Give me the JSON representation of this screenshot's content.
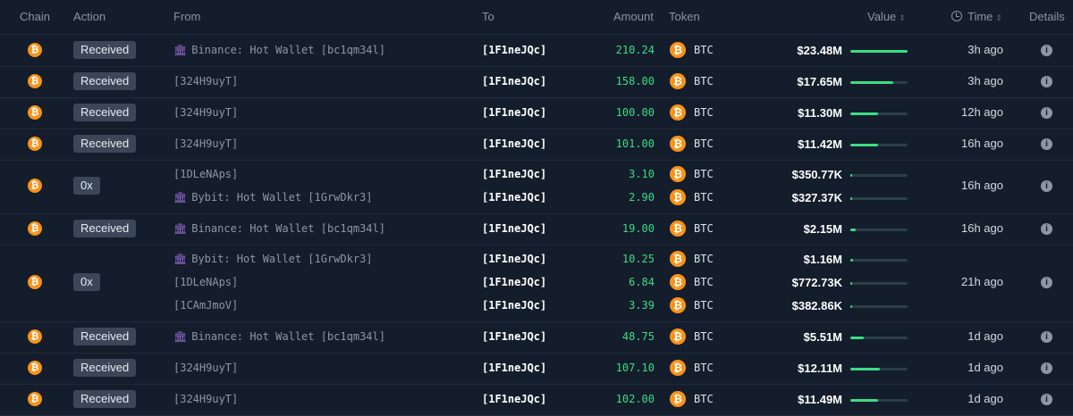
{
  "headers": {
    "chain": "Chain",
    "action": "Action",
    "from": "From",
    "to": "To",
    "amount": "Amount",
    "token": "Token",
    "value": "Value",
    "time": "Time",
    "details": "Details"
  },
  "icons": {
    "coin_glyph": "₿",
    "bank_glyph": "🏛",
    "info_glyph": "i",
    "sort_glyph": "⇕"
  },
  "colors": {
    "background": "#141d2b",
    "amount_green": "#3ddc84",
    "btc_orange": "#f7931a",
    "badge_bg": "#3b4658"
  },
  "rows": [
    {
      "action": "Received",
      "time": "3h ago",
      "lines": [
        {
          "from": "Binance: Hot Wallet [bc1qm34l]",
          "entity": true,
          "to": "[1F1neJQc]",
          "amount": "210.24",
          "token": "BTC",
          "value": "$23.48M",
          "bar": 1.0
        }
      ]
    },
    {
      "action": "Received",
      "time": "3h ago",
      "lines": [
        {
          "from": "[324H9uyT]",
          "entity": false,
          "to": "[1F1neJQc]",
          "amount": "158.00",
          "token": "BTC",
          "value": "$17.65M",
          "bar": 0.75
        }
      ]
    },
    {
      "action": "Received",
      "time": "12h ago",
      "lines": [
        {
          "from": "[324H9uyT]",
          "entity": false,
          "to": "[1F1neJQc]",
          "amount": "100.00",
          "token": "BTC",
          "value": "$11.30M",
          "bar": 0.48
        }
      ]
    },
    {
      "action": "Received",
      "time": "16h ago",
      "lines": [
        {
          "from": "[324H9uyT]",
          "entity": false,
          "to": "[1F1neJQc]",
          "amount": "101.00",
          "token": "BTC",
          "value": "$11.42M",
          "bar": 0.49
        }
      ]
    },
    {
      "action": "0x",
      "time": "16h ago",
      "lines": [
        {
          "from": "[1DLeNAps]",
          "entity": false,
          "to": "[1F1neJQc]",
          "amount": "3.10",
          "token": "BTC",
          "value": "$350.77K",
          "bar": 0.0
        },
        {
          "from": "Bybit: Hot Wallet [1GrwDkr3]",
          "entity": true,
          "to": "[1F1neJQc]",
          "amount": "2.90",
          "token": "BTC",
          "value": "$327.37K",
          "bar": 0.0
        }
      ]
    },
    {
      "action": "Received",
      "time": "16h ago",
      "lines": [
        {
          "from": "Binance: Hot Wallet [bc1qm34l]",
          "entity": true,
          "to": "[1F1neJQc]",
          "amount": "19.00",
          "token": "BTC",
          "value": "$2.15M",
          "bar": 0.09
        }
      ]
    },
    {
      "action": "0x",
      "time": "21h ago",
      "lines": [
        {
          "from": "Bybit: Hot Wallet [1GrwDkr3]",
          "entity": true,
          "to": "[1F1neJQc]",
          "amount": "10.25",
          "token": "BTC",
          "value": "$1.16M",
          "bar": 0.05
        },
        {
          "from": "[1DLeNAps]",
          "entity": false,
          "to": "[1F1neJQc]",
          "amount": "6.84",
          "token": "BTC",
          "value": "$772.73K",
          "bar": 0.03
        },
        {
          "from": "[1CAmJmoV]",
          "entity": false,
          "to": "[1F1neJQc]",
          "amount": "3.39",
          "token": "BTC",
          "value": "$382.86K",
          "bar": 0.02
        }
      ]
    },
    {
      "action": "Received",
      "time": "1d ago",
      "lines": [
        {
          "from": "Binance: Hot Wallet [bc1qm34l]",
          "entity": true,
          "to": "[1F1neJQc]",
          "amount": "48.75",
          "token": "BTC",
          "value": "$5.51M",
          "bar": 0.23
        }
      ]
    },
    {
      "action": "Received",
      "time": "1d ago",
      "lines": [
        {
          "from": "[324H9uyT]",
          "entity": false,
          "to": "[1F1neJQc]",
          "amount": "107.10",
          "token": "BTC",
          "value": "$12.11M",
          "bar": 0.52
        }
      ]
    },
    {
      "action": "Received",
      "time": "1d ago",
      "lines": [
        {
          "from": "[324H9uyT]",
          "entity": false,
          "to": "[1F1neJQc]",
          "amount": "102.00",
          "token": "BTC",
          "value": "$11.49M",
          "bar": 0.49
        }
      ]
    }
  ]
}
